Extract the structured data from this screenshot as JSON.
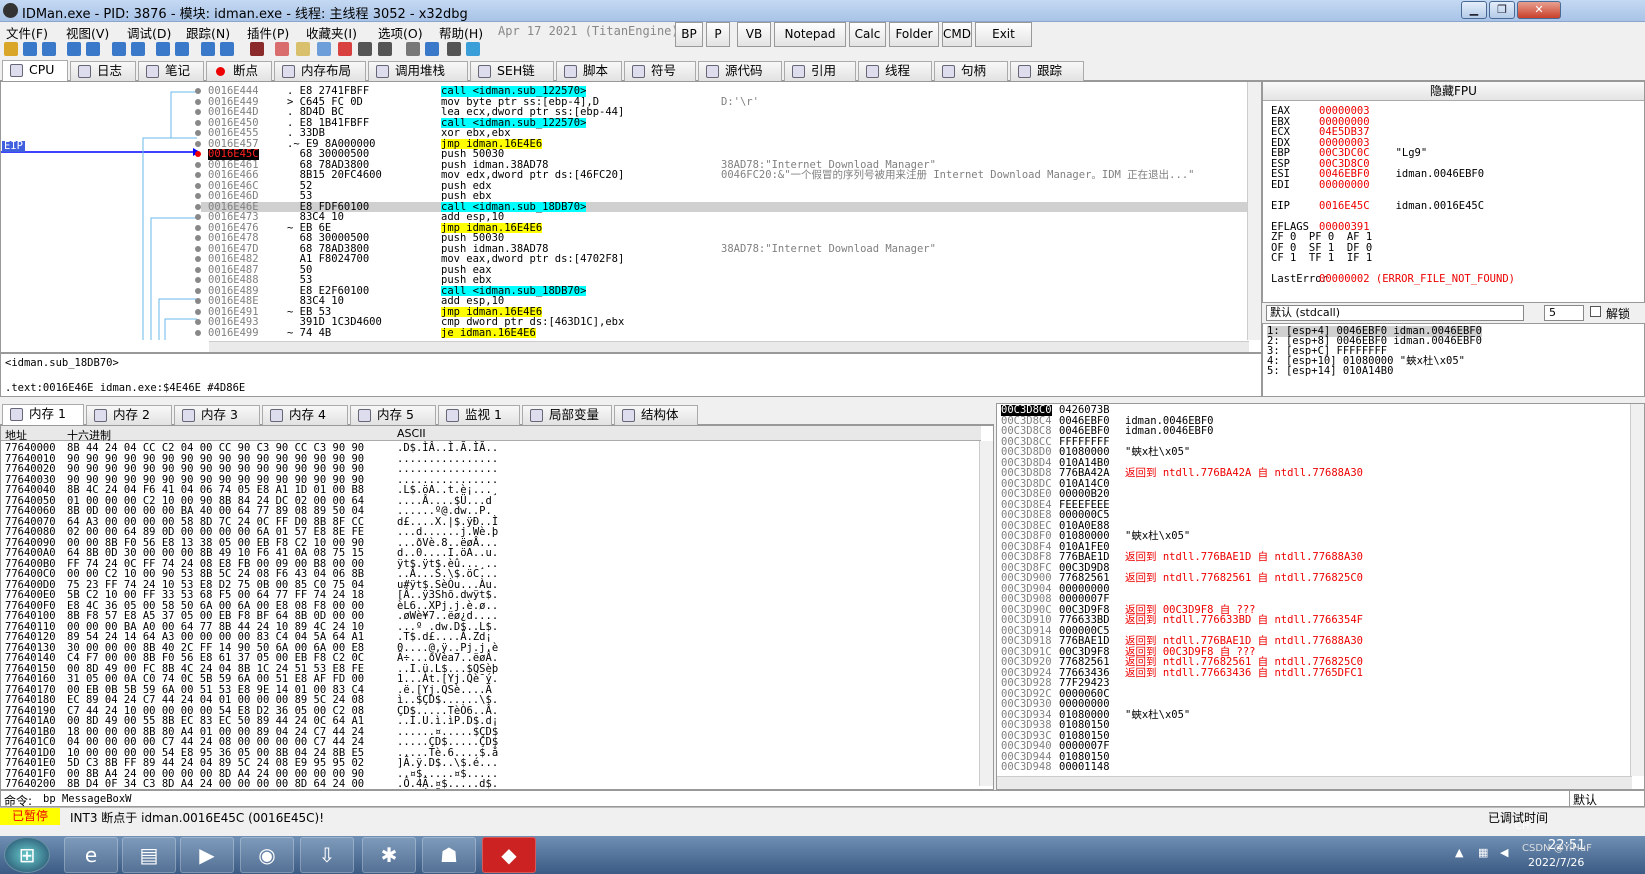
{
  "window": {
    "title": "IDMan.exe - PID: 3876 - 模块: idman.exe - 线程: 主线程 3052 - x32dbg",
    "min": "▁",
    "max": "❐",
    "close": "✕"
  },
  "menu": [
    "文件(F)",
    "视图(V)",
    "调试(D)",
    "跟踪(N)",
    "插件(P)",
    "收藏夹(I)",
    "选项(O)",
    "帮助(H)"
  ],
  "date_info": "Apr 17 2021 (TitanEngine)",
  "toolbar_buttons": [
    "BP",
    "P",
    "VB",
    "Notepad",
    "Calc",
    "Folder",
    "CMD",
    "Exit"
  ],
  "tabs": [
    "CPU",
    "日志",
    "笔记",
    "断点",
    "内存布局",
    "调用堆栈",
    "SEH链",
    "脚本",
    "符号",
    "源代码",
    "引用",
    "线程",
    "句柄",
    "跟踪"
  ],
  "disasm": {
    "eip_label": "EIP",
    "lines": [
      {
        "addr": "0016E444",
        "bytes": ". E8 2741FBFF",
        "ins": "call <idman.sub_122570>",
        "t": "call",
        "cmt": ""
      },
      {
        "addr": "0016E449",
        "bytes": "> C645 FC 0D",
        "ins": "mov byte ptr ss:[ebp-4],D",
        "t": "",
        "cmt": "D:'\\r'"
      },
      {
        "addr": "0016E44D",
        "bytes": ". 8D4D BC",
        "ins": "lea ecx,dword ptr ss:[ebp-44]",
        "t": "",
        "cmt": ""
      },
      {
        "addr": "0016E450",
        "bytes": ". E8 1B41FBFF",
        "ins": "call <idman.sub_122570>",
        "t": "call",
        "cmt": ""
      },
      {
        "addr": "0016E455",
        "bytes": ". 33DB",
        "ins": "xor ebx,ebx",
        "t": "",
        "cmt": ""
      },
      {
        "addr": "0016E457",
        "bytes": ".~ E9 8A000000",
        "ins": "jmp idman.16E4E6",
        "t": "jmp",
        "cmt": ""
      },
      {
        "addr": "0016E45C",
        "bytes": "  68 30000500",
        "ins": "push 50030",
        "t": "",
        "cmt": "",
        "eip": true
      },
      {
        "addr": "0016E461",
        "bytes": "  68 78AD3800",
        "ins": "push idman.38AD78",
        "t": "",
        "cmt": "38AD78:\"Internet Download Manager\""
      },
      {
        "addr": "0016E466",
        "bytes": "  8B15 20FC4600",
        "ins": "mov edx,dword ptr ds:[46FC20]",
        "t": "",
        "cmt": "0046FC20:&\"一个假冒的序列号被用来注册 Internet Download Manager。IDM 正在退出...\""
      },
      {
        "addr": "0016E46C",
        "bytes": "  52",
        "ins": "push edx",
        "t": "",
        "cmt": ""
      },
      {
        "addr": "0016E46D",
        "bytes": "  53",
        "ins": "push ebx",
        "t": "",
        "cmt": ""
      },
      {
        "addr": "0016E46E",
        "bytes": "  E8 FDF60100",
        "ins": "call <idman.sub_18DB70>",
        "t": "call",
        "cmt": "",
        "hl": true
      },
      {
        "addr": "0016E473",
        "bytes": "  83C4 10",
        "ins": "add esp,10",
        "t": "",
        "cmt": ""
      },
      {
        "addr": "0016E476",
        "bytes": "~ EB 6E",
        "ins": "jmp idman.16E4E6",
        "t": "jmp",
        "cmt": ""
      },
      {
        "addr": "0016E478",
        "bytes": "  68 30000500",
        "ins": "push 50030",
        "t": "",
        "cmt": ""
      },
      {
        "addr": "0016E47D",
        "bytes": "  68 78AD3800",
        "ins": "push idman.38AD78",
        "t": "",
        "cmt": "38AD78:\"Internet Download Manager\""
      },
      {
        "addr": "0016E482",
        "bytes": "  A1 F8024700",
        "ins": "mov eax,dword ptr ds:[4702F8]",
        "t": "",
        "cmt": ""
      },
      {
        "addr": "0016E487",
        "bytes": "  50",
        "ins": "push eax",
        "t": "",
        "cmt": ""
      },
      {
        "addr": "0016E488",
        "bytes": "  53",
        "ins": "push ebx",
        "t": "",
        "cmt": ""
      },
      {
        "addr": "0016E489",
        "bytes": "  E8 E2F60100",
        "ins": "call <idman.sub_18DB70>",
        "t": "call",
        "cmt": ""
      },
      {
        "addr": "0016E48E",
        "bytes": "  83C4 10",
        "ins": "add esp,10",
        "t": "",
        "cmt": ""
      },
      {
        "addr": "0016E491",
        "bytes": "~ EB 53",
        "ins": "jmp idman.16E4E6",
        "t": "jmp",
        "cmt": ""
      },
      {
        "addr": "0016E493",
        "bytes": "  391D 1C3D4600",
        "ins": "cmp dword ptr ds:[463D1C],ebx",
        "t": "",
        "cmt": ""
      },
      {
        "addr": "0016E499",
        "bytes": "~ 74 4B",
        "ins": "je idman.16E4E6",
        "t": "jmp",
        "cmt": ""
      }
    ]
  },
  "info": {
    "line1": "<idman.sub_18DB70>",
    "line2": ".text:0016E46E idman.exe:$4E46E #4D86E"
  },
  "registers": {
    "title": "隐藏FPU",
    "rows": [
      {
        "n": "EAX",
        "v": "00000003",
        "c": ""
      },
      {
        "n": "EBX",
        "v": "00000000",
        "c": ""
      },
      {
        "n": "ECX",
        "v": "04E5DB37",
        "c": ""
      },
      {
        "n": "EDX",
        "v": "00000003",
        "c": ""
      },
      {
        "n": "EBP",
        "v": "00C3DC0C",
        "c": "\"Lg9\""
      },
      {
        "n": "ESP",
        "v": "00C3D8C0",
        "c": ""
      },
      {
        "n": "ESI",
        "v": "0046EBF0",
        "c": "idman.0046EBF0"
      },
      {
        "n": "EDI",
        "v": "00000000",
        "c": ""
      },
      {
        "n": "",
        "v": "",
        "c": ""
      },
      {
        "n": "EIP",
        "v": "0016E45C",
        "c": "idman.0016E45C"
      },
      {
        "n": "",
        "v": "",
        "c": ""
      },
      {
        "n": "EFLAGS",
        "v": "00000391",
        "c": ""
      },
      {
        "n": "ZF 0  PF 0  AF 1",
        "v": "",
        "c": ""
      },
      {
        "n": "OF 0  SF 1  DF 0",
        "v": "",
        "c": ""
      },
      {
        "n": "CF 1  TF 1  IF 1",
        "v": "",
        "c": ""
      },
      {
        "n": "",
        "v": "",
        "c": ""
      },
      {
        "n": "LastError",
        "v": "00000002 (ERROR_FILE_NOT_FOUND)",
        "c": ""
      }
    ]
  },
  "callconv": {
    "value": "默认 (stdcall)",
    "count": "5",
    "unlock": "解锁"
  },
  "args": [
    "1: [esp+4] 0046EBF0 idman.0046EBF0",
    "2: [esp+8] 0046EBF0 idman.0046EBF0",
    "3: [esp+C] FFFFFFFF",
    "4: [esp+10] 01080000 \"蛺x杜\\x05\"",
    "5: [esp+14] 010A14B0"
  ],
  "memtabs": [
    "内存 1",
    "内存 2",
    "内存 3",
    "内存 4",
    "内存 5",
    "监视 1",
    "局部变量",
    "结构体"
  ],
  "dump": {
    "headers": [
      "地址",
      "十六进制",
      "ASCII"
    ],
    "rows": [
      [
        "77640000",
        "8B 44 24 04 CC C2 04 00 CC 90 C3 90 CC C3 90 90",
        ".D$.ÌÂ..Ì.Ã.ÌÃ.."
      ],
      [
        "77640010",
        "90 90 90 90 90 90 90 90 90 90 90 90 90 90 90 90",
        "................"
      ],
      [
        "77640020",
        "90 90 90 90 90 90 90 90 90 90 90 90 90 90 90 90",
        "................"
      ],
      [
        "77640030",
        "90 90 90 90 90 90 90 90 90 90 90 90 90 90 90 90",
        "................"
      ],
      [
        "77640040",
        "8B 4C 24 04 F6 41 04 06 74 05 E8 A1 1D 01 00 B8",
        ".L$.öA..t.è¡...¸"
      ],
      [
        "77640050",
        "01 00 00 00 C2 10 00 90 8B 84 24 DC 02 00 00 64",
        "....Â....$Ü...d"
      ],
      [
        "77640060",
        "8B 0D 00 00 00 00 BA 40 00 64 77 89 08 89 50 04",
        "......º@.dw..P."
      ],
      [
        "77640070",
        "64 A3 00 00 00 00 58 8D 7C 24 0C FF D0 8B 8F CC",
        "d£....X.|$.ÿÐ..Ì"
      ],
      [
        "77640080",
        "02 00 00 64 89 0D 00 00 00 00 6A 01 57 E8 8E FE",
        "...d......j.Wè.þ"
      ],
      [
        "77640090",
        "00 00 8B F0 56 E8 13 38 05 00 EB F8 C2 10 00 90",
        "...ðVè.8..ëøÂ..."
      ],
      [
        "776400A0",
        "64 8B 0D 30 00 00 00 8B 49 10 F6 41 0A 08 75 15",
        "d..0....I.öA..u."
      ],
      [
        "776400B0",
        "FF 74 24 0C FF 74 24 08 E8 FB 00 09 00 B8 00 00",
        "ÿt$.ÿt$.èû...¸.."
      ],
      [
        "776400C0",
        "00 00 C2 10 00 90 53 8B 5C 24 08 F6 43 04 06 8B",
        "..Â...S.\\$.öC..."
      ],
      [
        "776400D0",
        "75 23 FF 74 24 10 53 E8 D2 75 0B 00 85 C0 75 04",
        "u#ÿt$.SèÒu...Àu."
      ],
      [
        "776400E0",
        "5B C2 10 00 FF 33 53 68 F5 00 64 77 FF 74 24 18",
        "[Â..ÿ3Shõ.dwÿt$."
      ],
      [
        "776400F0",
        "E8 4C 36 05 00 58 50 6A 00 6A 00 E8 08 F8 00 00",
        "èL6..XPj.j.è.ø.."
      ],
      [
        "77640100",
        "8B F8 57 E8 A5 37 05 00 EB F8 BF 64 8B 0D 00 00",
        ".øWè¥7..ëø¿d...."
      ],
      [
        "77640110",
        "00 00 00 BA A0 00 64 77 8B 44 24 10 89 4C 24 10",
        "...º .dw.D$..L$."
      ],
      [
        "77640120",
        "89 54 24 14 64 A3 00 00 00 00 83 C4 04 5A 64 A1",
        ".T$.d£....Ä.Zd¡"
      ],
      [
        "77640130",
        "30 00 00 00 8B 40 2C FF 14 90 50 6A 00 6A 00 E8",
        "0....@,ÿ..Pj.j.è"
      ],
      [
        "77640140",
        "C4 F7 00 00 8B F0 56 E8 61 37 05 00 EB F8 C2 0C",
        "Ä÷...ðVèa7..ëøÂ."
      ],
      [
        "77640150",
        "00 8D 49 00 FC 8B 4C 24 04 8B 1C 24 51 53 E8 FE",
        "..I.ü.L$...$QSèþ"
      ],
      [
        "77640160",
        "31 05 00 0A C0 74 0C 5B 59 6A 00 51 E8 AF FD 00",
        "1...Àt.[Yj.Qè¯ý."
      ],
      [
        "77640170",
        "00 EB 0B 5B 59 6A 00 51 53 E8 9E 14 01 00 83 C4",
        ".ë.[Yj.QSè....Ä"
      ],
      [
        "77640180",
        "EC 89 04 24 C7 44 24 04 01 00 00 00 89 5C 24 08",
        "ì..$ÇD$......\\$."
      ],
      [
        "77640190",
        "C7 44 24 10 00 00 00 00 54 E8 D2 36 05 00 C2 08",
        "ÇD$.....TèÒ6..Â."
      ],
      [
        "776401A0",
        "00 8D 49 00 55 8B EC 83 EC 50 89 44 24 0C 64 A1",
        "..I.U.ì.ìP.D$.d¡"
      ],
      [
        "776401B0",
        "18 00 00 00 8B 80 A4 01 00 00 89 04 24 C7 44 24",
        "......¤.....$ÇD$"
      ],
      [
        "776401C0",
        "04 00 00 00 00 C7 44 24 08 00 00 00 00 C7 44 24",
        ".....ÇD$.....ÇD$"
      ],
      [
        "776401D0",
        "10 00 00 00 00 54 E8 95 36 05 00 8B 04 24 8B E5",
        ".....Tè.6....$.å"
      ],
      [
        "776401E0",
        "5D C3 8B FF 89 44 24 04 89 5C 24 08 E9 95 95 02",
        "]Ã.ÿ.D$..\\$.é..."
      ],
      [
        "776401F0",
        "00 8B A4 24 00 00 00 00 8D A4 24 00 00 00 00 90",
        "..¤$.....¤$....."
      ],
      [
        "77640200",
        "8B D4 0F 34 C3 8D A4 24 00 00 00 00 8D 64 24 00",
        ".Ô.4Ã.¤$.....d$."
      ],
      [
        "77640210",
        "8D 54 24 08 CD 2E C3 90 8B FF 55 8B EC 9C 81 EC",
        ".T$.Í.Ã..ÿU.ì..ì"
      ]
    ]
  },
  "stack": [
    [
      "00C3D8C0",
      "0426073B",
      "",
      ""
    ],
    [
      "00C3D8C4",
      "0046EBF0",
      "idman.0046EBF0",
      ""
    ],
    [
      "00C3D8C8",
      "0046EBF0",
      "idman.0046EBF0",
      ""
    ],
    [
      "00C3D8CC",
      "FFFFFFFF",
      "",
      ""
    ],
    [
      "00C3D8D0",
      "01080000",
      "\"蛺x杜\\x05\"",
      ""
    ],
    [
      "00C3D8D4",
      "010A14B0",
      "",
      ""
    ],
    [
      "00C3D8D8",
      "776BA42A",
      "返回到 ntdll.776BA42A 自 ntdll.77688A30",
      "r"
    ],
    [
      "00C3D8DC",
      "010A14C0",
      "",
      ""
    ],
    [
      "00C3D8E0",
      "00000B20",
      "",
      ""
    ],
    [
      "00C3D8E4",
      "FEEEFEEE",
      "",
      ""
    ],
    [
      "00C3D8E8",
      "000000C5",
      "",
      ""
    ],
    [
      "00C3D8EC",
      "010A0E88",
      "",
      ""
    ],
    [
      "00C3D8F0",
      "01080000",
      "\"蛺x杜\\x05\"",
      ""
    ],
    [
      "00C3D8F4",
      "010A1FE0",
      "",
      ""
    ],
    [
      "00C3D8F8",
      "776BAE1D",
      "返回到 ntdll.776BAE1D 自 ntdll.77688A30",
      "r"
    ],
    [
      "00C3D8FC",
      "00C3D9D8",
      "",
      ""
    ],
    [
      "00C3D900",
      "77682561",
      "返回到 ntdll.77682561 自 ntdll.776825C0",
      "r"
    ],
    [
      "00C3D904",
      "00000000",
      "",
      ""
    ],
    [
      "00C3D908",
      "0000007F",
      "",
      ""
    ],
    [
      "00C3D90C",
      "00C3D9F8",
      "返回到 00C3D9F8 自 ???",
      "r"
    ],
    [
      "00C3D910",
      "776633BD",
      "返回到 ntdll.776633BD 自 ntdll.7766354F",
      "r"
    ],
    [
      "00C3D914",
      "000000C5",
      "",
      ""
    ],
    [
      "00C3D918",
      "776BAE1D",
      "返回到 ntdll.776BAE1D 自 ntdll.77688A30",
      "r"
    ],
    [
      "00C3D91C",
      "00C3D9F8",
      "返回到 00C3D9F8 自 ???",
      "r"
    ],
    [
      "00C3D920",
      "77682561",
      "返回到 ntdll.77682561 自 ntdll.776825C0",
      "r"
    ],
    [
      "00C3D924",
      "77663436",
      "返回到 ntdll.77663436 自 ntdll.7765DFC1",
      "r"
    ],
    [
      "00C3D928",
      "77F29423",
      "",
      ""
    ],
    [
      "00C3D92C",
      "0000060C",
      "",
      ""
    ],
    [
      "00C3D930",
      "00000000",
      "",
      ""
    ],
    [
      "00C3D934",
      "01080000",
      "\"蛺x杜\\x05\"",
      ""
    ],
    [
      "00C3D938",
      "01080150",
      "",
      ""
    ],
    [
      "00C3D93C",
      "01080150",
      "",
      ""
    ],
    [
      "00C3D940",
      "0000007F",
      "",
      ""
    ],
    [
      "00C3D944",
      "01080150",
      "",
      ""
    ],
    [
      "00C3D948",
      "00001148",
      "",
      ""
    ]
  ],
  "command": {
    "label": "命令:",
    "value": "bp MessageBoxW",
    "mode": "默认"
  },
  "status": {
    "state": "已暂停",
    "message": "INT3 断点于 idman.0016E45C (0016E45C)!",
    "right": "已调试时间"
  },
  "taskbar": {
    "time": "22:51",
    "date": "2022/7/26",
    "watermark": "CSDN @YiHuF",
    "lang": "CH"
  },
  "colors": {
    "call_bg": "#00ffff",
    "jmp_bg": "#ffff00",
    "ret_text": "#e00000",
    "paused_bg": "#ffff00"
  }
}
